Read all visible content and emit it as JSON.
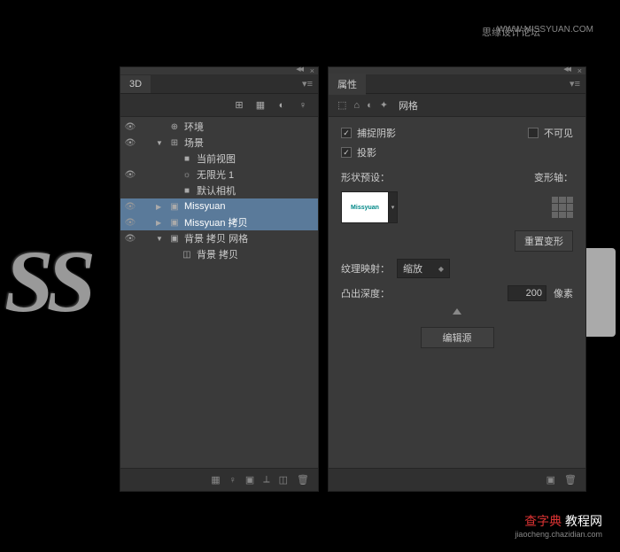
{
  "watermarks": {
    "top_right_site": "WWW.MISSYUAN.COM",
    "top_right_forum": "思缘设计论坛",
    "bottom_brand_a": "查字典",
    "bottom_brand_b": " 教程网",
    "bottom_url": "jiaocheng.chazidian.com"
  },
  "bg_text": "SS",
  "panel3d": {
    "tab": "3D",
    "tree": [
      {
        "label": "环境",
        "indent": 1,
        "icon": "globe",
        "eye": true,
        "arrow": ""
      },
      {
        "label": "场景",
        "indent": 1,
        "icon": "scene",
        "eye": true,
        "arrow": "▼"
      },
      {
        "label": "当前视图",
        "indent": 2,
        "icon": "camera",
        "eye": false,
        "arrow": ""
      },
      {
        "label": "无限光 1",
        "indent": 2,
        "icon": "light",
        "eye": true,
        "arrow": ""
      },
      {
        "label": "默认相机",
        "indent": 2,
        "icon": "camera",
        "eye": false,
        "arrow": ""
      },
      {
        "label": "Missyuan",
        "indent": 1,
        "icon": "mesh",
        "eye": true,
        "arrow": "▶",
        "selected": true
      },
      {
        "label": "Missyuan 拷贝",
        "indent": 1,
        "icon": "mesh",
        "eye": true,
        "arrow": "▶",
        "selected": true
      },
      {
        "label": "背景 拷贝 网格",
        "indent": 1,
        "icon": "mesh",
        "eye": true,
        "arrow": "▼"
      },
      {
        "label": "背景 拷贝",
        "indent": 2,
        "icon": "material",
        "eye": false,
        "arrow": ""
      }
    ]
  },
  "panelProps": {
    "tab": "属性",
    "mode_label": "网格",
    "checks": {
      "catch_shadow": "捕捉阴影",
      "invisible": "不可见",
      "cast_shadow": "投影"
    },
    "shape_preset": "形状预设：",
    "thumb_text": "Missyuan",
    "deform_axis": "变形轴：",
    "reset_deform": "重置变形",
    "texture_map": "纹理映射：",
    "texture_value": "缩放",
    "extrude_depth": "凸出深度：",
    "extrude_value": "200",
    "extrude_unit": "像素",
    "edit_source": "编辑源"
  }
}
